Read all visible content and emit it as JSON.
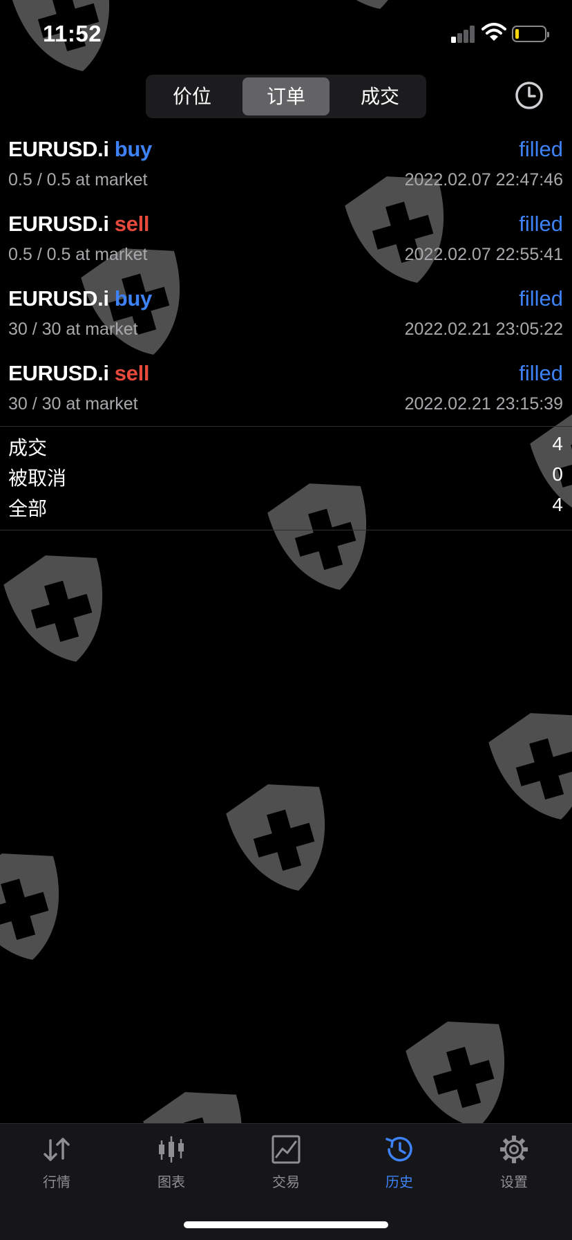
{
  "status_bar": {
    "time": "11:52"
  },
  "segments": [
    {
      "label": "价位",
      "active": false
    },
    {
      "label": "订单",
      "active": true
    },
    {
      "label": "成交",
      "active": false
    }
  ],
  "orders": [
    {
      "symbol": "EURUSD.i",
      "side": "buy",
      "status": "filled",
      "volume": "0.5 / 0.5 at market",
      "time": "2022.02.07 22:47:46"
    },
    {
      "symbol": "EURUSD.i",
      "side": "sell",
      "status": "filled",
      "volume": "0.5 / 0.5 at market",
      "time": "2022.02.07 22:55:41"
    },
    {
      "symbol": "EURUSD.i",
      "side": "buy",
      "status": "filled",
      "volume": "30 / 30 at market",
      "time": "2022.02.21 23:05:22"
    },
    {
      "symbol": "EURUSD.i",
      "side": "sell",
      "status": "filled",
      "volume": "30 / 30 at market",
      "time": "2022.02.21 23:15:39"
    }
  ],
  "summary": [
    {
      "label": "成交",
      "count": "4"
    },
    {
      "label": "被取消",
      "count": "0"
    },
    {
      "label": "全部",
      "count": "4"
    }
  ],
  "tabs": [
    {
      "label": "行情",
      "icon": "arrows-updown-icon",
      "active": false
    },
    {
      "label": "图表",
      "icon": "candlestick-icon",
      "active": false
    },
    {
      "label": "交易",
      "icon": "trade-chart-icon",
      "active": false
    },
    {
      "label": "历史",
      "icon": "history-icon",
      "active": true
    },
    {
      "label": "设置",
      "icon": "gear-icon",
      "active": false
    }
  ],
  "colors": {
    "accent": "#3d82f7",
    "sell": "#e8493d",
    "muted": "#a9a9ad",
    "background": "#000000"
  }
}
